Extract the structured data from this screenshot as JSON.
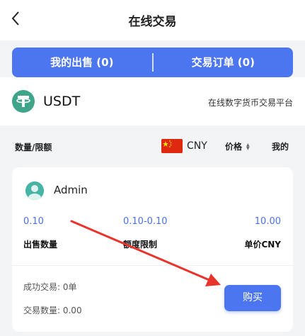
{
  "header": {
    "title": "在线交易"
  },
  "tabs": [
    {
      "label": "我的出售 (0)"
    },
    {
      "label": "交易订单 (0)"
    }
  ],
  "asset": {
    "coin": "USDT",
    "platform": "在线数字货币交易平台",
    "logo_color": "#3ea58a"
  },
  "filter": {
    "label": "数量/限额",
    "currency": "CNY",
    "price_label": "价格",
    "mine_label": "我的"
  },
  "offer": {
    "merchant": "Admin",
    "quantity_value": "0.10",
    "quantity_label": "出售数量",
    "limit_value": "0.10-0.10",
    "limit_label": "额度限制",
    "price_value": "10.00",
    "price_label": "单价CNY",
    "success_trades": "成功交易: 0单",
    "trade_volume": "交易数量: 0.00",
    "buy_label": "购买"
  },
  "colors": {
    "accent": "#4c76f0",
    "value_text": "#4a72e8",
    "annotation_arrow": "#e8342c"
  }
}
